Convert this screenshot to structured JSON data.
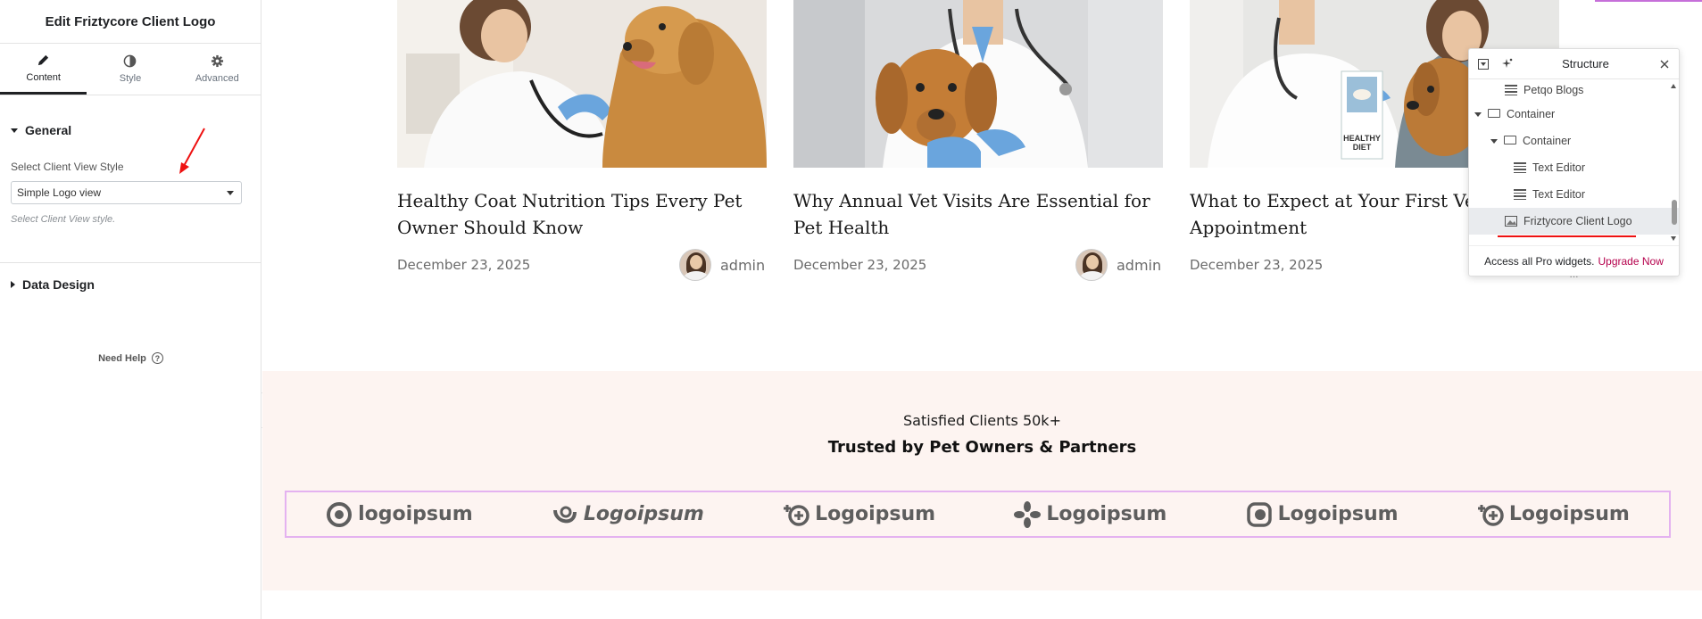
{
  "panel": {
    "title": "Edit Friztycore Client Logo",
    "tabs": [
      {
        "label": "Content",
        "icon": "pencil-icon"
      },
      {
        "label": "Style",
        "icon": "half-circle-icon"
      },
      {
        "label": "Advanced",
        "icon": "gear-icon"
      }
    ],
    "general": {
      "heading": "General",
      "select_label": "Select Client View Style",
      "select_value": "Simple Logo view",
      "select_help": "Select Client View style."
    },
    "data_design": {
      "heading": "Data Design"
    },
    "need_help": "Need Help",
    "help_icon": "?"
  },
  "posts": [
    {
      "title": "Healthy Coat Nutrition Tips Every Pet Owner Should Know",
      "date": "December 23, 2025",
      "author": "admin"
    },
    {
      "title": "Why Annual Vet Visits Are Essential for Pet Health",
      "date": "December 23, 2025",
      "author": "admin"
    },
    {
      "title": "What to Expect at Your First Vet Appointment",
      "date": "December 23, 2025"
    }
  ],
  "image3_badge": [
    "HEALTHY",
    "DIET"
  ],
  "clients": {
    "subtitle": "Satisfied Clients 50k+",
    "title": "Trusted by Pet Owners & Partners",
    "logos": [
      "logoipsum",
      "Logoipsum",
      "Logoipsum",
      "Logoipsum",
      "Logoipsum",
      "Logoipsum"
    ]
  },
  "structure": {
    "title": "Structure",
    "rows": [
      {
        "label": "Petqo Blogs",
        "icon": "list-icon"
      },
      {
        "label": "Container",
        "icon": "container-icon"
      },
      {
        "label": "Container",
        "icon": "container-icon"
      },
      {
        "label": "Text Editor",
        "icon": "text-editor-icon"
      },
      {
        "label": "Text Editor",
        "icon": "text-editor-icon"
      },
      {
        "label": "Friztycore Client Logo",
        "icon": "image-icon"
      }
    ],
    "footer_text": "Access all Pro widgets.",
    "upgrade_label": "Upgrade Now",
    "more_label": "..."
  },
  "colors": {
    "accent": "#b5004c",
    "clients_bg": "#fdf4f1",
    "logo_border": "#e4b2f0",
    "arrow": "#e11"
  }
}
